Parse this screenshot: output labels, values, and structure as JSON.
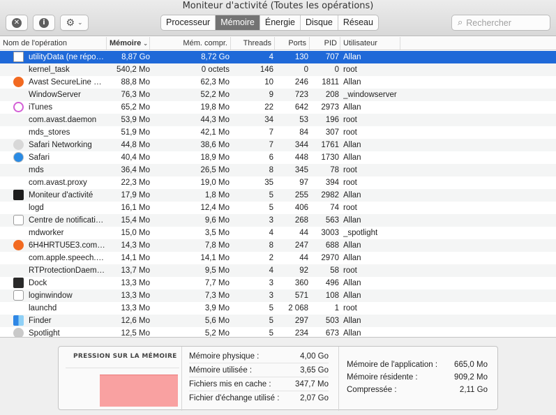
{
  "window": {
    "title": "Moniteur d'activité (Toutes les opérations)"
  },
  "toolbar": {
    "close_process_glyph": "✕",
    "info_glyph": "i",
    "gear_glyph": "⚙",
    "chevron_glyph": "⌄",
    "tabs": [
      {
        "label": "Processeur",
        "active": false
      },
      {
        "label": "Mémoire",
        "active": true
      },
      {
        "label": "Énergie",
        "active": false
      },
      {
        "label": "Disque",
        "active": false
      },
      {
        "label": "Réseau",
        "active": false
      }
    ],
    "search": {
      "placeholder": "Rechercher",
      "value": "",
      "glyph": "⌕"
    }
  },
  "columns": {
    "name": "Nom de l'opération",
    "memory": "Mémoire",
    "sort_glyph": "⌄",
    "compressed": "Mém. compr.",
    "threads": "Threads",
    "ports": "Ports",
    "pid": "PID",
    "user": "Utilisateur"
  },
  "processes": [
    {
      "icon": "document-icon",
      "name": "utilityData (ne répo…",
      "memory": "8,87 Go",
      "compressed": "8,72 Go",
      "threads": "4",
      "ports": "130",
      "pid": "707",
      "user": "Allan",
      "selected": true
    },
    {
      "icon": "",
      "name": "kernel_task",
      "memory": "540,2 Mo",
      "compressed": "0 octets",
      "threads": "146",
      "ports": "0",
      "pid": "0",
      "user": "root"
    },
    {
      "icon": "avast-icon",
      "name": "Avast SecureLine V…",
      "memory": "88,8 Mo",
      "compressed": "62,3 Mo",
      "threads": "10",
      "ports": "246",
      "pid": "1811",
      "user": "Allan"
    },
    {
      "icon": "",
      "name": "WindowServer",
      "memory": "76,3 Mo",
      "compressed": "52,2 Mo",
      "threads": "9",
      "ports": "723",
      "pid": "208",
      "user": "_windowserver"
    },
    {
      "icon": "itunes-icon",
      "name": "iTunes",
      "memory": "65,2 Mo",
      "compressed": "19,8 Mo",
      "threads": "22",
      "ports": "642",
      "pid": "2973",
      "user": "Allan"
    },
    {
      "icon": "",
      "name": "com.avast.daemon",
      "memory": "53,9 Mo",
      "compressed": "44,3 Mo",
      "threads": "34",
      "ports": "53",
      "pid": "196",
      "user": "root"
    },
    {
      "icon": "",
      "name": "mds_stores",
      "memory": "51,9 Mo",
      "compressed": "42,1 Mo",
      "threads": "7",
      "ports": "84",
      "pid": "307",
      "user": "root"
    },
    {
      "icon": "network-icon",
      "name": "Safari Networking",
      "memory": "44,8 Mo",
      "compressed": "38,6 Mo",
      "threads": "7",
      "ports": "344",
      "pid": "1761",
      "user": "Allan"
    },
    {
      "icon": "safari-icon",
      "name": "Safari",
      "memory": "40,4 Mo",
      "compressed": "18,9 Mo",
      "threads": "6",
      "ports": "448",
      "pid": "1730",
      "user": "Allan"
    },
    {
      "icon": "",
      "name": "mds",
      "memory": "36,4 Mo",
      "compressed": "26,5 Mo",
      "threads": "8",
      "ports": "345",
      "pid": "78",
      "user": "root"
    },
    {
      "icon": "",
      "name": "com.avast.proxy",
      "memory": "22,3 Mo",
      "compressed": "19,0 Mo",
      "threads": "35",
      "ports": "97",
      "pid": "394",
      "user": "root"
    },
    {
      "icon": "activity-monitor-icon",
      "name": "Moniteur d'activité",
      "memory": "17,9 Mo",
      "compressed": "1,8 Mo",
      "threads": "5",
      "ports": "255",
      "pid": "2982",
      "user": "Allan"
    },
    {
      "icon": "",
      "name": "logd",
      "memory": "16,1 Mo",
      "compressed": "12,4 Mo",
      "threads": "5",
      "ports": "406",
      "pid": "74",
      "user": "root"
    },
    {
      "icon": "notification-center-icon",
      "name": "Centre de notificati…",
      "memory": "15,4 Mo",
      "compressed": "9,6 Mo",
      "threads": "3",
      "ports": "268",
      "pid": "563",
      "user": "Allan"
    },
    {
      "icon": "",
      "name": "mdworker",
      "memory": "15,0 Mo",
      "compressed": "3,5 Mo",
      "threads": "4",
      "ports": "44",
      "pid": "3003",
      "user": "_spotlight"
    },
    {
      "icon": "avast-icon",
      "name": "6H4HRTU5E3.com.…",
      "memory": "14,3 Mo",
      "compressed": "7,8 Mo",
      "threads": "8",
      "ports": "247",
      "pid": "688",
      "user": "Allan"
    },
    {
      "icon": "",
      "name": "com.apple.speech.…",
      "memory": "14,1 Mo",
      "compressed": "14,1 Mo",
      "threads": "2",
      "ports": "44",
      "pid": "2970",
      "user": "Allan"
    },
    {
      "icon": "",
      "name": "RTProtectionDaem…",
      "memory": "13,7 Mo",
      "compressed": "9,5 Mo",
      "threads": "4",
      "ports": "92",
      "pid": "58",
      "user": "root"
    },
    {
      "icon": "dock-icon",
      "name": "Dock",
      "memory": "13,3 Mo",
      "compressed": "7,7 Mo",
      "threads": "3",
      "ports": "360",
      "pid": "496",
      "user": "Allan"
    },
    {
      "icon": "loginwindow-icon",
      "name": "loginwindow",
      "memory": "13,3 Mo",
      "compressed": "7,3 Mo",
      "threads": "3",
      "ports": "571",
      "pid": "108",
      "user": "Allan"
    },
    {
      "icon": "",
      "name": "launchd",
      "memory": "13,3 Mo",
      "compressed": "3,9 Mo",
      "threads": "5",
      "ports": "2 068",
      "pid": "1",
      "user": "root"
    },
    {
      "icon": "finder-icon",
      "name": "Finder",
      "memory": "12,6 Mo",
      "compressed": "5,6 Mo",
      "threads": "5",
      "ports": "297",
      "pid": "503",
      "user": "Allan"
    },
    {
      "icon": "spotlight-icon",
      "name": "Spotlight",
      "memory": "12,5 Mo",
      "compressed": "5,2 Mo",
      "threads": "5",
      "ports": "234",
      "pid": "673",
      "user": "Allan"
    }
  ],
  "memory_panel": {
    "pressure_title": "PRESSION SUR LA MÉMOIRE",
    "pressure_color": "#f9a1a1",
    "stats_left": [
      {
        "label": "Mémoire physique :",
        "value": "4,00 Go"
      },
      {
        "label": "Mémoire utilisée :",
        "value": "3,65 Go"
      },
      {
        "label": "Fichiers mis en cache :",
        "value": "347,7 Mo"
      },
      {
        "label": "Fichier d'échange utilisé :",
        "value": "2,07 Go"
      }
    ],
    "stats_right": [
      {
        "label": "Mémoire de l'application :",
        "value": "665,0 Mo"
      },
      {
        "label": "Mémoire résidente :",
        "value": "909,2 Mo"
      },
      {
        "label": "Compressée :",
        "value": "2,11 Go"
      }
    ]
  },
  "colors": {
    "selection": "#1f69d8",
    "active_tab": "#737373"
  }
}
